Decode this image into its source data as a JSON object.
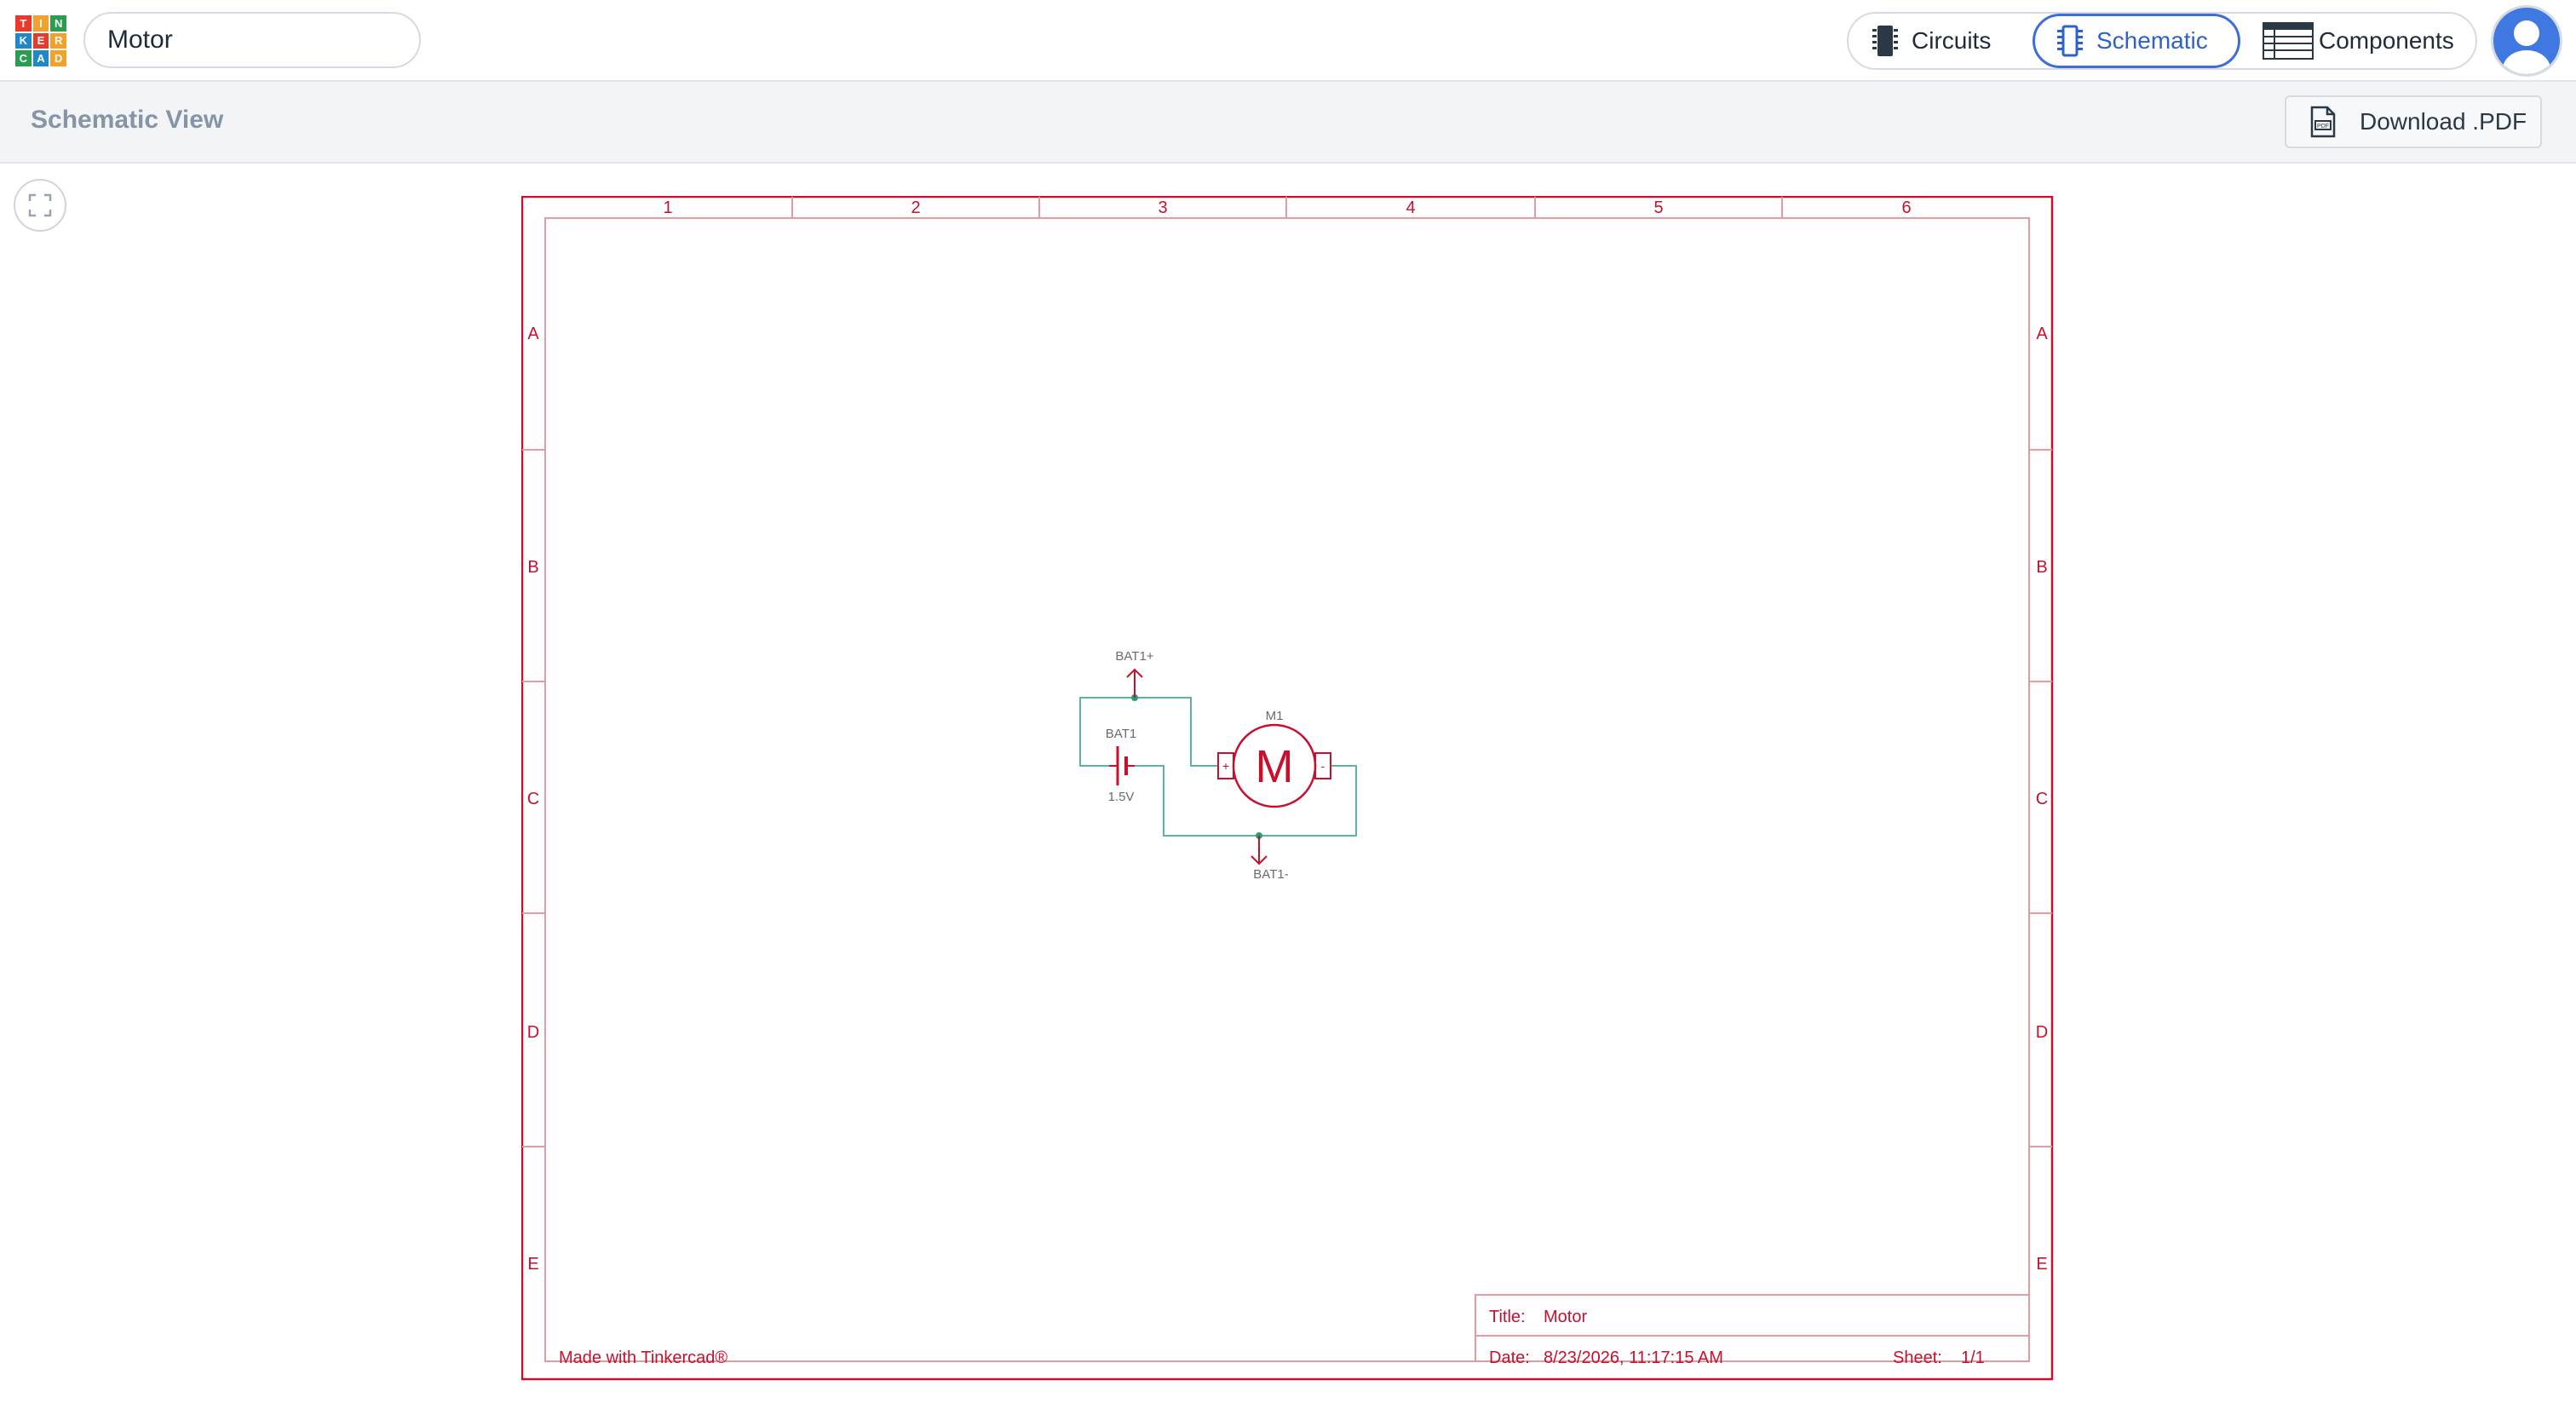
{
  "app": {
    "project_title": "Motor",
    "logo_letters": [
      "T",
      "I",
      "N",
      "K",
      "E",
      "R",
      "C",
      "A",
      "D"
    ],
    "logo_colors": [
      "#e8392d",
      "#f2a12b",
      "#2a9d4e",
      "#1e88c9",
      "#e8392d",
      "#f2a12b",
      "#2a9d4e",
      "#1e88c9",
      "#f2a12b"
    ]
  },
  "view_switch": {
    "circuits_label": "Circuits",
    "schematic_label": "Schematic",
    "components_label": "Components",
    "active": "Schematic"
  },
  "subheader": {
    "title": "Schematic View",
    "download_label": "Download .PDF"
  },
  "sheet": {
    "columns": [
      "1",
      "2",
      "3",
      "4",
      "5",
      "6"
    ],
    "rows": [
      "A",
      "B",
      "C",
      "D",
      "E"
    ],
    "footer_credit": "Made with Tinkercad®",
    "title_label": "Title:",
    "title_value": "Motor",
    "date_label": "Date:",
    "date_value": "8/23/2026, 11:17:15 AM",
    "sheet_label": "Sheet:",
    "sheet_value": "1/1"
  },
  "circuit": {
    "battery_ref": "BAT1",
    "battery_value": "1.5V",
    "net_positive": "BAT1+",
    "net_negative": "BAT1-",
    "motor_ref": "M1",
    "motor_symbol": "M",
    "plus_sign": "+",
    "minus_sign": "-"
  },
  "colors": {
    "accent": "#3b6fd6",
    "schematic_red": "#c8102e",
    "wire_teal": "#5fb3a3",
    "node_green": "#2a9d72"
  },
  "icons": {
    "circuits": "chip-icon",
    "schematic": "schematic-chip-icon",
    "components": "table-list-icon",
    "download": "pdf-file-icon",
    "fit": "fit-to-view-icon",
    "avatar": "user-avatar-icon"
  }
}
